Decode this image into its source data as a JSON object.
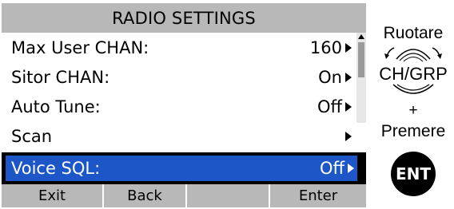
{
  "screen": {
    "title": "RADIO SETTINGS",
    "rows": [
      {
        "label": "Max User CHAN:",
        "value": "160"
      },
      {
        "label": "Sitor CHAN:",
        "value": "On"
      },
      {
        "label": "Auto Tune:",
        "value": "Off"
      },
      {
        "label": "Scan",
        "value": ""
      }
    ],
    "selected_row": {
      "label": "Voice SQL:",
      "value": "Off"
    },
    "softkeys": [
      "Exit",
      "Back",
      "",
      "Enter"
    ]
  },
  "instructions": {
    "rotate": "Ruotare",
    "knob_label": "CH/GRP",
    "plus": "+",
    "press": "Premere",
    "button": "ENT"
  },
  "colors": {
    "title_bar": "#b8b8b8",
    "selection": "#1d56c6",
    "softkey_bar": "#b8b8b8"
  }
}
